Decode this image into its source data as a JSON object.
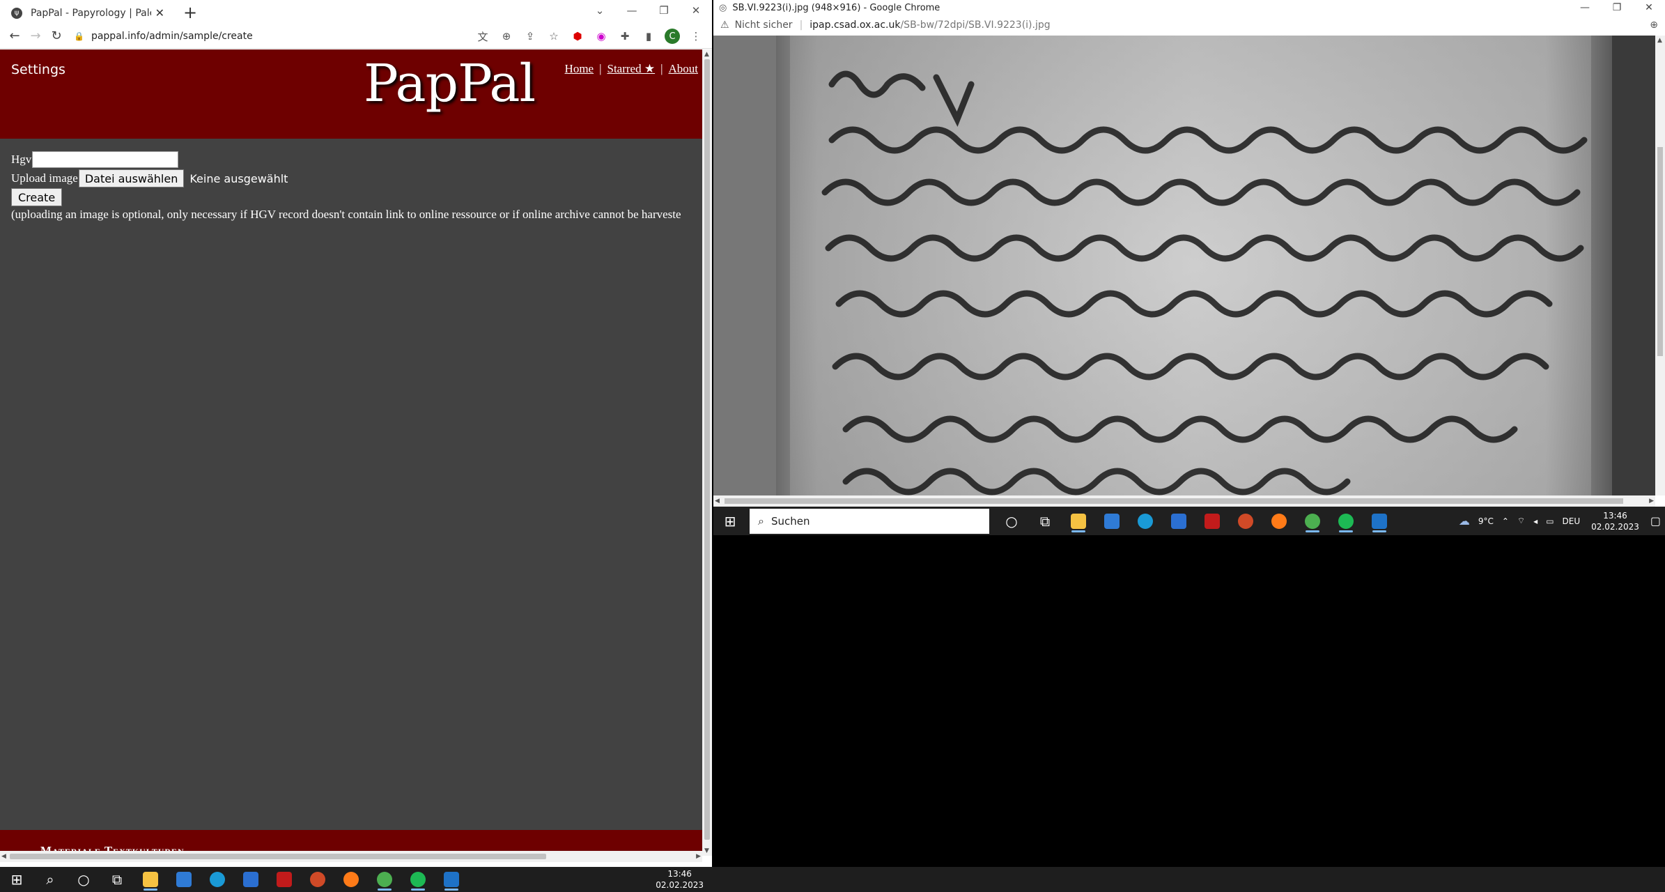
{
  "left_window": {
    "tab_title": "PapPal - Papyrology | Paleograph",
    "tab_favicon": "ψ",
    "url": "pappal.info/admin/sample/create",
    "avatar_letter": "C"
  },
  "page": {
    "settings_label": "Settings",
    "logo": "PapPal",
    "nav": {
      "home": "Home",
      "starred": "Starred ★",
      "about": "About",
      "sep": "|"
    },
    "form": {
      "hgv_label": "Hgv",
      "hgv_value": "",
      "upload_label": "Upload image",
      "file_button": "Datei auswählen",
      "file_none": "Keine ausgewählt",
      "create_button": "Create",
      "note": "(uploading an image is optional, only necessary if HGV record doesn't contain link to online ressource or if online archive cannot be harveste"
    },
    "footer_text": "Materiale Textkulturen"
  },
  "right_window": {
    "title": "SB.VI.9223(i).jpg (948×916) - Google Chrome",
    "security": "Nicht sicher",
    "url_host": "ipap.csad.ox.ac.uk",
    "url_path": "/SB-bw/72dpi/SB.VI.9223(i).jpg"
  },
  "taskbar_right": {
    "search_placeholder": "Suchen",
    "weather": "9°C",
    "lang": "DEU",
    "time": "13:46",
    "date": "02.02.2023"
  },
  "taskbar_main": {
    "time": "13:46",
    "date": "02.02.2023"
  },
  "colors": {
    "header_red": "#6e0000",
    "page_bg": "#424242"
  }
}
